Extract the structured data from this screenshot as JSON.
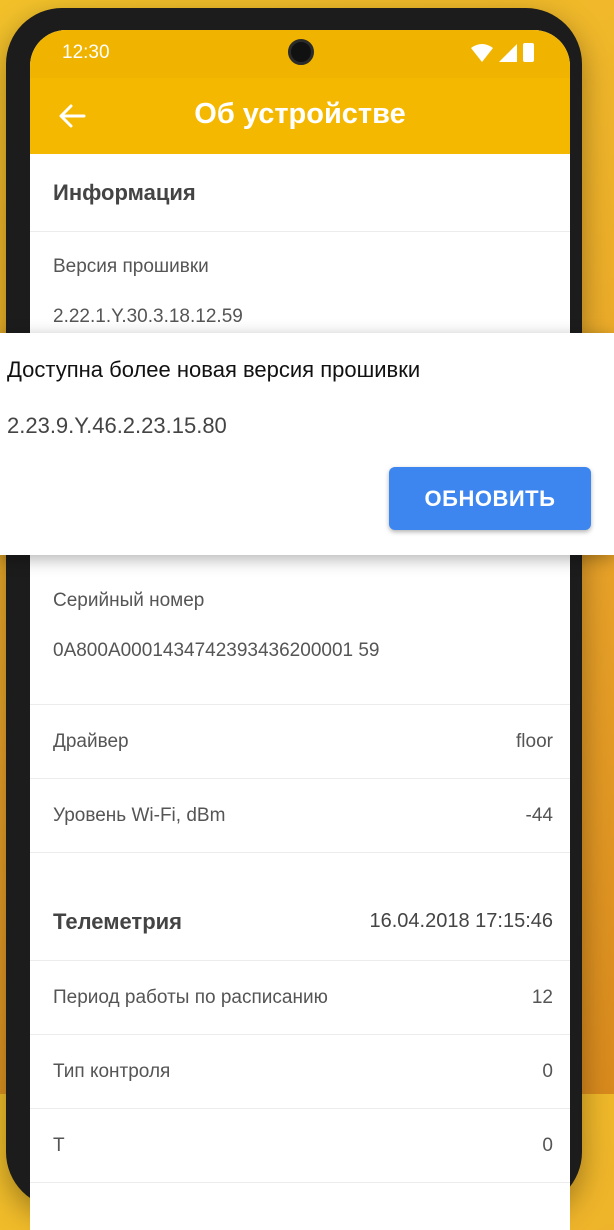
{
  "status_bar": {
    "time": "12:30"
  },
  "app_bar": {
    "title": "Об устройстве"
  },
  "info": {
    "header": "Информация",
    "firmware_label": "Версия прошивки",
    "firmware_value": "2.22.1.Y.30.3.18.12.59",
    "serial_label": "Серийный номер",
    "serial_value": "0A800A0001434742393436200001 59",
    "driver_label": "Драйвер",
    "driver_value": "floor",
    "wifi_label": "Уровень Wi-Fi, dBm",
    "wifi_value": "-44"
  },
  "telemetry": {
    "header": "Телеметрия",
    "timestamp": "16.04.2018 17:15:46",
    "schedule_label": "Период работы по расписанию",
    "schedule_value": "12",
    "control_label": "Тип контроля",
    "control_value": "0",
    "partial_label": "Т",
    "partial_value": "0"
  },
  "update_dialog": {
    "title": "Доступна более новая версия прошивки",
    "version": "2.23.9.Y.46.2.23.15.80",
    "button": "ОБНОВИТЬ"
  },
  "colors": {
    "accent": "#f5b800",
    "button": "#3d86f0"
  }
}
